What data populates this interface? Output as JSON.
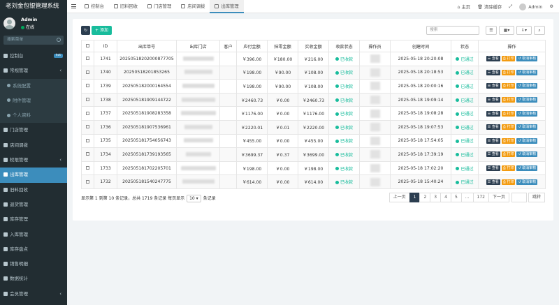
{
  "app": {
    "title": "老刘金包银管理系统"
  },
  "user": {
    "name": "Admin",
    "status": "在线"
  },
  "sidebar": {
    "search_placeholder": "搜索菜单",
    "items": [
      {
        "label": "控制台",
        "badge": "hot"
      },
      {
        "label": "常规管理"
      },
      {
        "label": "系统配置"
      },
      {
        "label": "附件管理"
      },
      {
        "label": "个人资料"
      },
      {
        "label": "门店管理"
      },
      {
        "label": "店间调拨"
      },
      {
        "label": "权限管理"
      },
      {
        "label": "出库管理"
      },
      {
        "label": "旧料回收"
      },
      {
        "label": "退货管理"
      },
      {
        "label": "库存管理"
      },
      {
        "label": "入库管理"
      },
      {
        "label": "库存盘点"
      },
      {
        "label": "销售明细"
      },
      {
        "label": "数据统计"
      },
      {
        "label": "会员管理"
      }
    ]
  },
  "topbar": {
    "tabs": [
      {
        "label": "控制台"
      },
      {
        "label": "旧料回收"
      },
      {
        "label": "门店管理"
      },
      {
        "label": "店间调拨"
      },
      {
        "label": "出库管理"
      }
    ],
    "home": "主页",
    "clear_cache": "清除缓存",
    "user": "Admin"
  },
  "toolbar": {
    "add_label": "添加",
    "search_placeholder": "搜索"
  },
  "table": {
    "headers": [
      "ID",
      "出库单号",
      "出库门店",
      "客户",
      "应付金额",
      "抹零金额",
      "实收金额",
      "收款状态",
      "操作员",
      "创建时间",
      "状态",
      "操作"
    ],
    "rows": [
      {
        "id": "1741",
        "no": "20250518202000877705",
        "due": "￥396.00",
        "round": "￥180.00",
        "paid": "￥216.00",
        "pay": "已收款",
        "time": "2025-05-18 20:20:08",
        "status": "已通过"
      },
      {
        "id": "1740",
        "no": "20250518201853265",
        "due": "￥198.00",
        "round": "￥90.00",
        "paid": "￥108.00",
        "pay": "已收款",
        "time": "2025-05-18 20:18:53",
        "status": "已通过"
      },
      {
        "id": "1739",
        "no": "202505182000164554",
        "due": "￥198.00",
        "round": "￥90.00",
        "paid": "￥108.00",
        "pay": "已收款",
        "time": "2025-05-18 20:00:16",
        "status": "已通过"
      },
      {
        "id": "1738",
        "no": "202505181909144722",
        "due": "￥2460.73",
        "round": "￥0.00",
        "paid": "￥2460.73",
        "pay": "已收款",
        "time": "2025-05-18 19:09:14",
        "status": "已通过"
      },
      {
        "id": "1737",
        "no": "202505181908283358",
        "due": "￥1176.00",
        "round": "￥0.00",
        "paid": "￥1176.00",
        "pay": "已收款",
        "time": "2025-05-18 19:08:28",
        "status": "已通过"
      },
      {
        "id": "1736",
        "no": "20250518190753696​1",
        "due": "￥2220.01",
        "round": "￥0.01",
        "paid": "￥2220.00",
        "pay": "已收款",
        "time": "2025-05-18 19:07:53",
        "status": "已通过"
      },
      {
        "id": "1735",
        "no": "202505181754056743",
        "due": "￥455.00",
        "round": "￥0.00",
        "paid": "￥455.00",
        "pay": "已收款",
        "time": "2025-05-18 17:54:05",
        "status": "已通过"
      },
      {
        "id": "1734",
        "no": "202505181739193565",
        "due": "￥3699.37",
        "round": "￥0.37",
        "paid": "￥3699.00",
        "pay": "已收款",
        "time": "2025-05-18 17:39:19",
        "status": "已通过"
      },
      {
        "id": "1733",
        "no": "202505181702205701",
        "due": "￥198.00",
        "round": "￥0.00",
        "paid": "￥198.00",
        "pay": "已收款",
        "time": "2025-05-18 17:02:20",
        "status": "已通过"
      },
      {
        "id": "1732",
        "no": "202505181540247775",
        "due": "￥614.00",
        "round": "￥0.00",
        "paid": "￥614.00",
        "pay": "已收款",
        "time": "2025-05-18 15:40:24",
        "status": "已通过"
      }
    ],
    "actions": {
      "view": "查看",
      "print": "打印",
      "cancel": "取消审核"
    }
  },
  "footer": {
    "info_prefix": "显示第 1 到第 10 条记录，总共 1719 条记录 每页显示",
    "page_size": "10",
    "info_suffix": "条记录",
    "pages": [
      "上一页",
      "1",
      "2",
      "3",
      "4",
      "5",
      "...",
      "172",
      "下一页"
    ],
    "current": "1",
    "go_label": "跳转"
  },
  "colors": {
    "sidebar": "#222d32",
    "active": "#3c8dbc",
    "success": "#18bc9c",
    "warning": "#f39c12",
    "dark": "#2c3e50"
  }
}
